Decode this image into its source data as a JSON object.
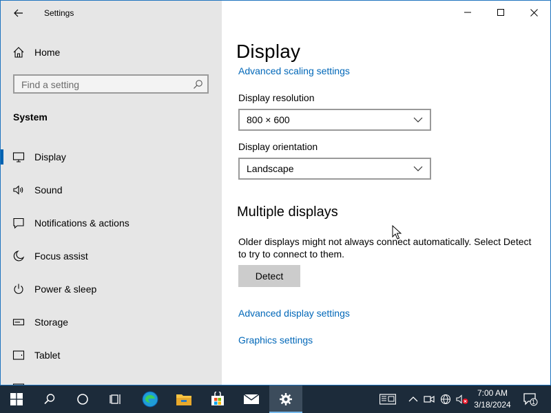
{
  "app": {
    "title": "Settings"
  },
  "sidebar": {
    "home_label": "Home",
    "search_placeholder": "Find a setting",
    "section_title": "System",
    "items": [
      {
        "label": "Display",
        "icon": "monitor-icon"
      },
      {
        "label": "Sound",
        "icon": "speaker-icon"
      },
      {
        "label": "Notifications & actions",
        "icon": "notification-icon"
      },
      {
        "label": "Focus assist",
        "icon": "moon-icon"
      },
      {
        "label": "Power & sleep",
        "icon": "power-icon"
      },
      {
        "label": "Storage",
        "icon": "storage-icon"
      },
      {
        "label": "Tablet",
        "icon": "tablet-icon"
      }
    ],
    "selected": "Display"
  },
  "main": {
    "title": "Display",
    "scaling_link": "Advanced scaling settings",
    "resolution": {
      "label": "Display resolution",
      "value": "800 × 600"
    },
    "orientation": {
      "label": "Display orientation",
      "value": "Landscape"
    },
    "multiple_displays": {
      "heading": "Multiple displays",
      "description": "Older displays might not always connect automatically. Select Detect to try to connect to them.",
      "detect_button": "Detect"
    },
    "advanced_display_link": "Advanced display settings",
    "graphics_link": "Graphics settings"
  },
  "taskbar": {
    "time": "7:00 AM",
    "date": "3/18/2024",
    "notification_count": "1",
    "apps": [
      "start-icon",
      "search-icon",
      "cortana-icon",
      "task-view-icon",
      "edge-icon",
      "file-explorer-icon",
      "store-icon",
      "mail-icon",
      "settings-gear-icon"
    ]
  },
  "colors": {
    "accent": "#0067b8",
    "sidebar_bg": "#e6e6e6",
    "taskbar_bg": "#1c2b3a"
  }
}
